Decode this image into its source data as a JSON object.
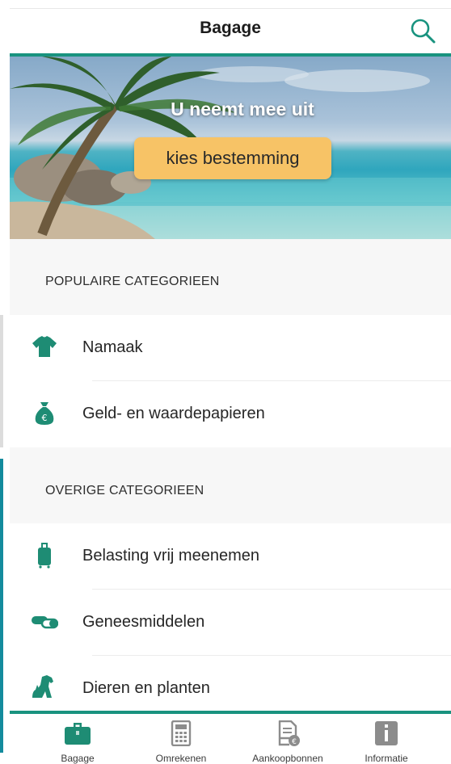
{
  "header": {
    "title": "Bagage",
    "search_icon": "search-icon"
  },
  "hero": {
    "title": "U neemt mee uit",
    "button_label": "kies bestemming"
  },
  "popular": {
    "title": "POPULAIRE CATEGORIEEN",
    "items": [
      {
        "label": "Namaak",
        "icon": "shirt-icon"
      },
      {
        "label": "Geld- en waardepapieren",
        "icon": "money-bag-icon"
      }
    ]
  },
  "other": {
    "title": "OVERIGE CATEGORIEEN",
    "items": [
      {
        "label": "Belasting vrij meenemen",
        "icon": "suitcase-icon"
      },
      {
        "label": "Geneesmiddelen",
        "icon": "pills-icon"
      },
      {
        "label": "Dieren en planten",
        "icon": "dog-cat-icon"
      }
    ]
  },
  "tabbar": {
    "tabs": [
      {
        "label": "Bagage",
        "icon": "briefcase-icon",
        "active": true
      },
      {
        "label": "Omrekenen",
        "icon": "calculator-icon",
        "active": false
      },
      {
        "label": "Aankoopbonnen",
        "icon": "receipt-icon",
        "active": false
      },
      {
        "label": "Informatie",
        "icon": "info-icon",
        "active": false
      }
    ]
  },
  "colors": {
    "accent": "#19937f",
    "icon": "#1e8c74",
    "button": "#f7c366",
    "tab_inactive": "#8c8c8c"
  }
}
